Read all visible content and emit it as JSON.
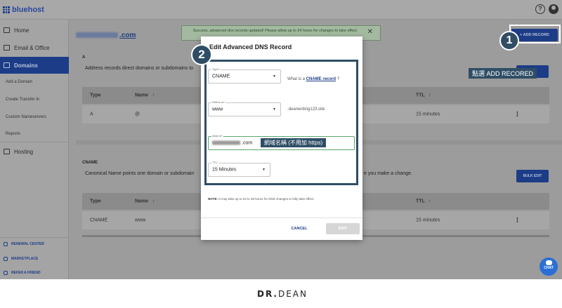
{
  "app": {
    "logo_text": "bluehost",
    "help_glyph": "?"
  },
  "sidebar": {
    "items": [
      {
        "label": "Home",
        "icon": "home-icon"
      },
      {
        "label": "Email & Office",
        "icon": "mail-icon"
      },
      {
        "label": "Domains",
        "icon": "domains-icon",
        "active": true
      },
      {
        "label": "Hosting",
        "icon": "hosting-icon"
      }
    ],
    "sub_items": [
      "Add a Domain",
      "Create Transfer In",
      "Custom Nameservers",
      "Reports"
    ],
    "bottom_items": [
      "RENEWAL CENTER",
      "MARKETPLACE",
      "REFER A FRIEND"
    ]
  },
  "main": {
    "domain_title": ".com",
    "add_record_label": "+ ADD RECORD",
    "a_section": {
      "label": "A",
      "description": "Address records direct domains or subdomains to",
      "headers": [
        "Type",
        "Name",
        "TTL"
      ],
      "rows": [
        {
          "type": "A",
          "name": "@",
          "ttl": "15 minutes"
        }
      ]
    },
    "cname_section": {
      "label": "CNAME",
      "description": "Canonical Name points one domain or subdomain",
      "description_tail": "e you make a change.",
      "bulk_edit_label": "BULK EDIT",
      "headers": [
        "Type",
        "Name",
        "TTL"
      ],
      "rows": [
        {
          "type": "CNAME",
          "name": "www",
          "ttl": "15 minutes"
        }
      ]
    }
  },
  "banner": {
    "text": "Success, advanced dns records updated! Please allow up to 24 hours for changes to take effect.",
    "close_glyph": "✕"
  },
  "modal": {
    "title": "Edit Advanced DNS Record",
    "type_label": "Type*",
    "type_value": "CNAME",
    "type_helper_prefix": "What is a",
    "type_helper_link": "CNAME record",
    "type_helper_suffix": "?",
    "refers_label": "Refers to*",
    "refers_value": "www",
    "refers_suffix": ".deanwriting123.site",
    "alias_label": "Alias to*",
    "alias_value_suffix": ".com",
    "ttl_label": "TTL*",
    "ttl_value": "15 Minutes",
    "note_bold": "NOTE:",
    "note_text": " It may take up to 24 to 48 hours for DNS changes to fully take effect.",
    "cancel_label": "CANCEL",
    "edit_label": "EDIT"
  },
  "annotations": {
    "step1": "1",
    "step1_note": "點選 ADD RECORED",
    "step2": "2",
    "alias_note": "網域名稱 (不用加 https)"
  },
  "chat": {
    "label": "CHAT"
  },
  "footer": {
    "brand_dr": "DR.",
    "brand_dean": "DEAN"
  },
  "colors": {
    "brand_blue": "#1d3c87",
    "annotation": "#2f4e66",
    "overlay": "#9c9c9c"
  }
}
